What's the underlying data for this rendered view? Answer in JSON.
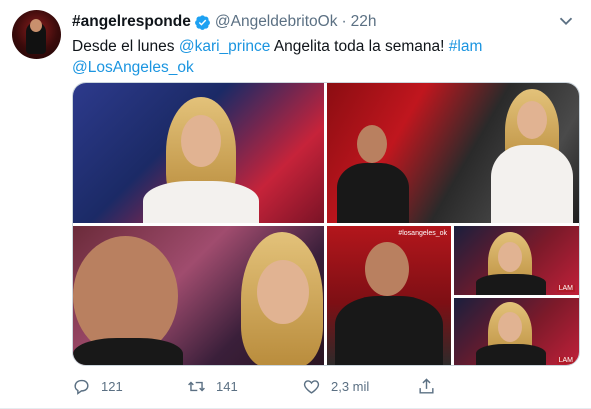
{
  "tweet": {
    "display_name": "#angelresponde",
    "handle": "@AngeldebritoOk",
    "separator": "·",
    "time": "22h",
    "text": {
      "part1": "Desde el lunes ",
      "mention1": "@kari_prince",
      "part2": " Angelita toda la semana! ",
      "hashtag": "#lam",
      "mention2": "@LosAngeles_ok"
    },
    "media_watermark": "#losangeles_ok",
    "media_logo": "LAM",
    "actions": {
      "reply": {
        "icon": "reply-icon",
        "count": "121"
      },
      "retweet": {
        "icon": "retweet-icon",
        "count": "141"
      },
      "like": {
        "icon": "heart-icon",
        "count": "2,3 mil"
      },
      "share": {
        "icon": "share-icon"
      }
    },
    "colors": {
      "link": "#1b95e0",
      "muted": "#5b7083",
      "verified": "#1da1f2"
    }
  }
}
